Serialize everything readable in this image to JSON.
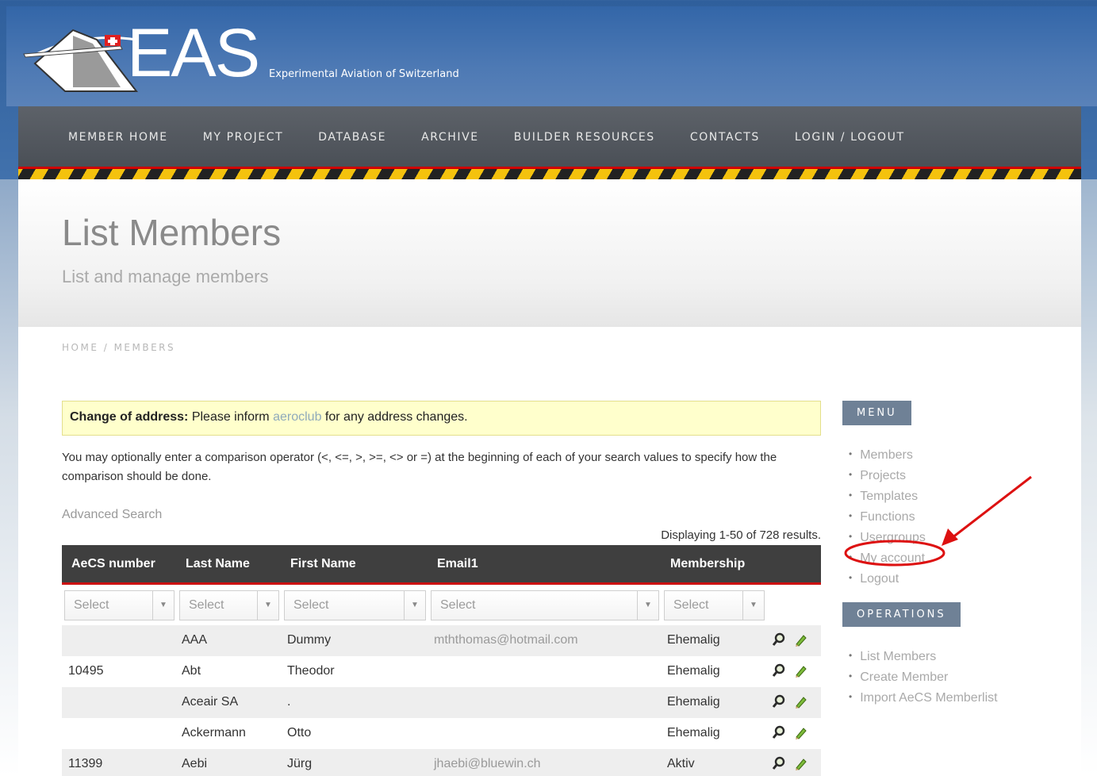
{
  "logo": {
    "text": "EAS",
    "tagline": "Experimental Aviation of Switzerland"
  },
  "nav": {
    "items": [
      "MEMBER HOME",
      "MY PROJECT",
      "DATABASE",
      "ARCHIVE",
      "BUILDER RESOURCES",
      "CONTACTS",
      "LOGIN / LOGOUT"
    ]
  },
  "page": {
    "title": "List Members",
    "subtitle": "List and manage members",
    "breadcrumb": "HOME / MEMBERS"
  },
  "notice": {
    "bold": "Change of address:",
    "text_before": "Please inform",
    "link": "aeroclub",
    "text_after": "for any address changes."
  },
  "hint": {
    "text": "You may optionally enter a comparison operator (<, <=, >, >=, <> or =) at the beginning of each of your search values to specify how the comparison should be done."
  },
  "advanced_search": "Advanced Search",
  "summary": "Displaying 1-50 of 728 results.",
  "table": {
    "headers": [
      "AeCS number",
      "Last Name",
      "First Name",
      "Email1",
      "Membership"
    ],
    "filter_placeholder": "Select",
    "rows": [
      {
        "aecs": "",
        "last": "AAA",
        "first": "Dummy",
        "email": "mththomas@hotmail.com",
        "membership": "Ehemalig"
      },
      {
        "aecs": "10495",
        "last": "Abt",
        "first": "Theodor",
        "email": "",
        "membership": "Ehemalig"
      },
      {
        "aecs": "",
        "last": "Aceair SA",
        "first": ".",
        "email": "",
        "membership": "Ehemalig"
      },
      {
        "aecs": "",
        "last": "Ackermann",
        "first": "Otto",
        "email": "",
        "membership": "Ehemalig"
      },
      {
        "aecs": "11399",
        "last": "Aebi",
        "first": "Jürg",
        "email": "jhaebi@bluewin.ch",
        "membership": "Aktiv"
      }
    ]
  },
  "sidebar": {
    "menu_title": "MENU",
    "menu_items": [
      "Members",
      "Projects",
      "Templates",
      "Functions",
      "Usergroups",
      "My account",
      "Logout"
    ],
    "operations_title": "OPERATIONS",
    "operations_items": [
      "List Members",
      "Create Member",
      "Import AeCS Memberlist"
    ]
  },
  "colors": {
    "annotation": "#dd1111",
    "table_header": "#3f3f3f",
    "accent_red": "#cc1111",
    "sidebar_heading": "#6f8196"
  }
}
